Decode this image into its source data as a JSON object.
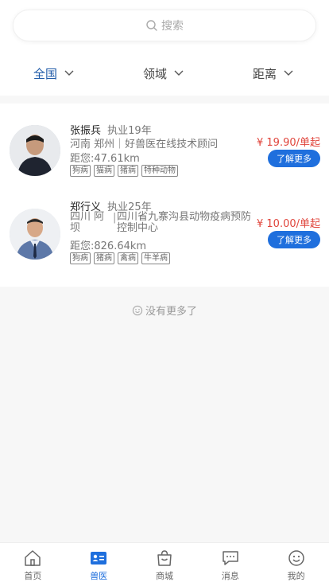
{
  "search": {
    "placeholder": "搜索"
  },
  "filters": [
    {
      "label": "全国",
      "active": true
    },
    {
      "label": "领域",
      "active": false
    },
    {
      "label": "距离",
      "active": false
    }
  ],
  "doctors": [
    {
      "name": "张振兵",
      "years": "执业19年",
      "location": "河南 郑州｜好兽医在线技术顾问",
      "distance": "距您:47.61km",
      "tags": [
        "狗病",
        "猫病",
        "猪病",
        "特种动物"
      ],
      "price": "¥ 19.90/单起",
      "button": "了解更多"
    },
    {
      "name": "郑行义",
      "years": "执业25年",
      "location_region": "四川 阿坝",
      "location_org": "四川省九寨沟县动物疫病预防控制中心",
      "distance": "距您:826.64km",
      "tags": [
        "狗病",
        "猪病",
        "禽病",
        "牛羊病"
      ],
      "price": "¥ 10.00/单起",
      "button": "了解更多"
    }
  ],
  "no_more": "没有更多了",
  "tabbar": [
    {
      "label": "首页",
      "icon": "home-icon",
      "active": false
    },
    {
      "label": "兽医",
      "icon": "vet-card-icon",
      "active": true
    },
    {
      "label": "商城",
      "icon": "shopping-bag-icon",
      "active": false
    },
    {
      "label": "消息",
      "icon": "message-icon",
      "active": false
    },
    {
      "label": "我的",
      "icon": "smiley-icon",
      "active": false
    }
  ],
  "colors": {
    "accent": "#1f6fdd",
    "price": "#e0453c",
    "filter_active": "#1e5aa8"
  }
}
